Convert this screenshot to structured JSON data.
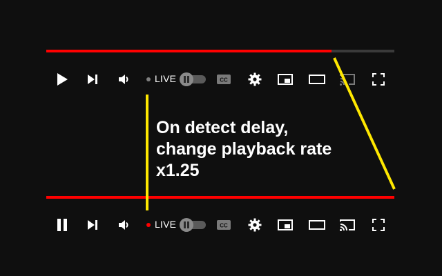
{
  "top_player": {
    "progress": 0.82,
    "progress_color": "#ff0000",
    "live_label": "LIVE",
    "live_dot_color": "#7f7f7f",
    "play_state_icon": "play-icon",
    "cast_icon_color": "#7a7a7a"
  },
  "bottom_player": {
    "progress": 1.0,
    "progress_color": "#ff0000",
    "live_label": "LIVE",
    "live_dot_color": "#ff0000",
    "play_state_icon": "pause-icon",
    "cast_icon_color": "#ffffff"
  },
  "caption": {
    "text": "On detect delay,\nchange playback rate\nx1.25"
  },
  "annotation_color": "#ffe800",
  "icons": [
    "play-icon",
    "pause-icon",
    "next-icon",
    "volume-icon",
    "autoplay-toggle",
    "cc-icon",
    "gear-icon",
    "miniplayer-icon",
    "theater-icon",
    "cast-icon",
    "fullscreen-icon"
  ]
}
